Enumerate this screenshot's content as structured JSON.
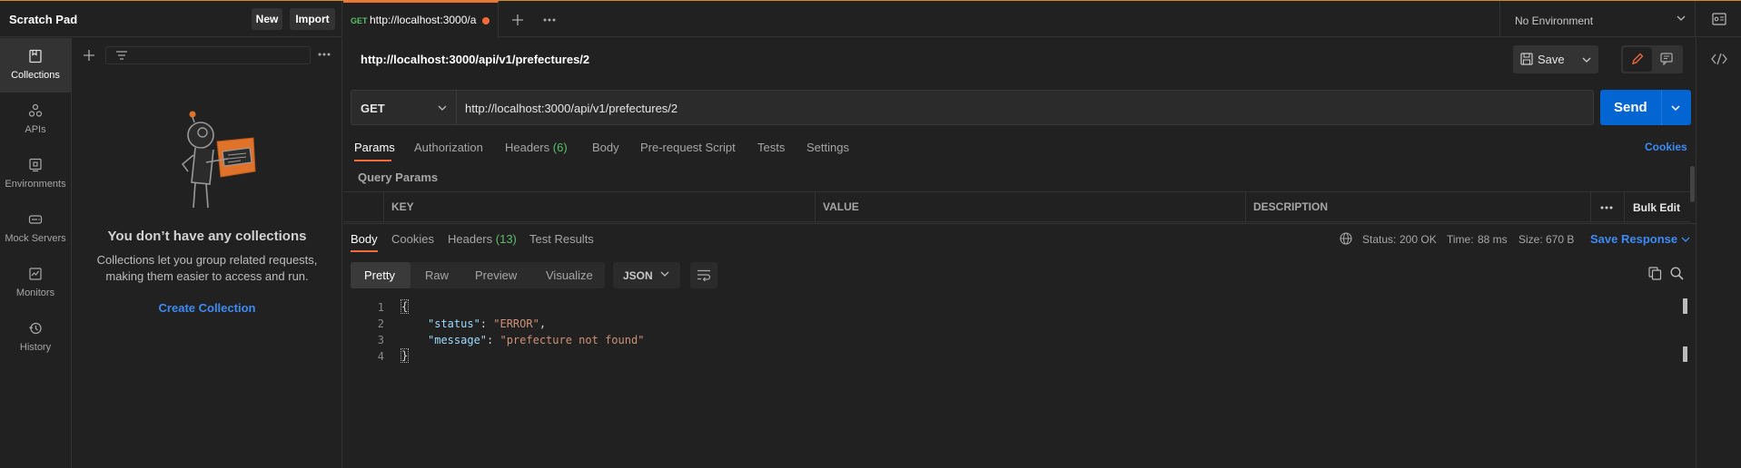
{
  "workspace": {
    "title": "Scratch Pad",
    "new_label": "New",
    "import_label": "Import"
  },
  "rail": {
    "items": [
      {
        "label": "Collections",
        "icon": "collections-icon",
        "active": true
      },
      {
        "label": "APIs",
        "icon": "apis-icon"
      },
      {
        "label": "Environments",
        "icon": "environments-icon"
      },
      {
        "label": "Mock Servers",
        "icon": "mock-servers-icon"
      },
      {
        "label": "Monitors",
        "icon": "monitors-icon"
      },
      {
        "label": "History",
        "icon": "history-icon"
      }
    ]
  },
  "collections": {
    "empty_title": "You don’t have any collections",
    "empty_desc": "Collections let you group related requests, making them easier to access and run.",
    "create_label": "Create Collection"
  },
  "tab": {
    "method": "GET",
    "url": "http://localhost:3000/api/v1/prefectures/2"
  },
  "environment": {
    "label": "No Environment"
  },
  "request": {
    "title": "http://localhost:3000/api/v1/prefectures/2",
    "save_label": "Save",
    "method": "GET",
    "url": "http://localhost:3000/api/v1/prefectures/2",
    "send_label": "Send",
    "tabs": {
      "params": "Params",
      "authorization": "Authorization",
      "headers": "Headers",
      "headers_count": "(6)",
      "body": "Body",
      "prerequest": "Pre-request Script",
      "tests": "Tests",
      "settings": "Settings"
    },
    "cookies_label": "Cookies",
    "query_params_label": "Query Params",
    "columns": {
      "key": "KEY",
      "value": "VALUE",
      "description": "DESCRIPTION"
    },
    "bulk_edit_label": "Bulk Edit"
  },
  "response": {
    "tabs": {
      "body": "Body",
      "cookies": "Cookies",
      "headers": "Headers",
      "headers_count": "(13)",
      "test_results": "Test Results"
    },
    "status_label": "Status:",
    "status_value": "200 OK",
    "time_label": "Time:",
    "time_value": "88 ms",
    "size_label": "Size:",
    "size_value": "670 B",
    "save_response_label": "Save Response",
    "views": {
      "pretty": "Pretty",
      "raw": "Raw",
      "preview": "Preview",
      "visualize": "Visualize"
    },
    "format": "JSON",
    "body_lines": {
      "n1": "1",
      "n2": "2",
      "n3": "3",
      "n4": "4",
      "open": "{",
      "close": "}",
      "key1": "\"status\"",
      "val1": "\"ERROR\"",
      "key2": "\"message\"",
      "val2": "\"prefecture not found\""
    }
  },
  "colors": {
    "accent": "#f26b3a",
    "send": "#0265d2",
    "link": "#3d8bf5",
    "success": "#5cbf6a"
  }
}
